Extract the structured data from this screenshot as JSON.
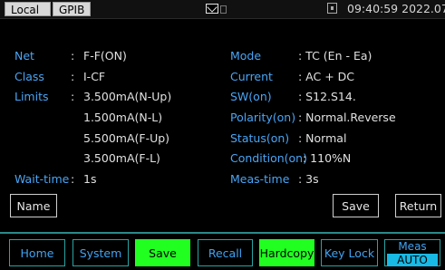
{
  "status_bar": {
    "local_label": "Local",
    "gpib_label": "GPIB",
    "datetime": "09:40:59 2022.07.21"
  },
  "params_left": [
    {
      "label": "Net",
      "value": "F-F(ON)"
    },
    {
      "label": "Class",
      "value": "I-CF"
    },
    {
      "label": "Limits",
      "value": "3.500mA(N-Up)"
    },
    {
      "label": "",
      "value": "1.500mA(N-L)"
    },
    {
      "label": "",
      "value": "5.500mA(F-Up)"
    },
    {
      "label": "",
      "value": "3.500mA(F-L)"
    },
    {
      "label": "Wait-time",
      "value": "1s"
    }
  ],
  "params_right": [
    {
      "label": "Mode",
      "value": ": TC (En - Ea)"
    },
    {
      "label": "Current",
      "value": ": AC + DC"
    },
    {
      "label": "SW(on)",
      "value": ": S12.S14."
    },
    {
      "label": "Polarity(on)",
      "value": ": Normal.Reverse"
    },
    {
      "label": "Status(on)",
      "value": ": Normal"
    },
    {
      "label": "Condition(on)",
      "value": ": 110%N"
    },
    {
      "label": "Meas-time",
      "value": ": 3s"
    }
  ],
  "colon": ":",
  "buttons": {
    "name": "Name",
    "save": "Save",
    "return": "Return"
  },
  "softkeys": {
    "home": "Home",
    "system": "System",
    "save": "Save",
    "recall": "Recall",
    "hardcopy": "Hardcopy",
    "key_lock": "Key Lock",
    "meas_title": "Meas",
    "meas_value": "AUTO"
  },
  "colors": {
    "label_blue": "#49a5f5",
    "softkey_active_green": "#21ff21",
    "meas_auto_cyan": "#18b9e5"
  }
}
